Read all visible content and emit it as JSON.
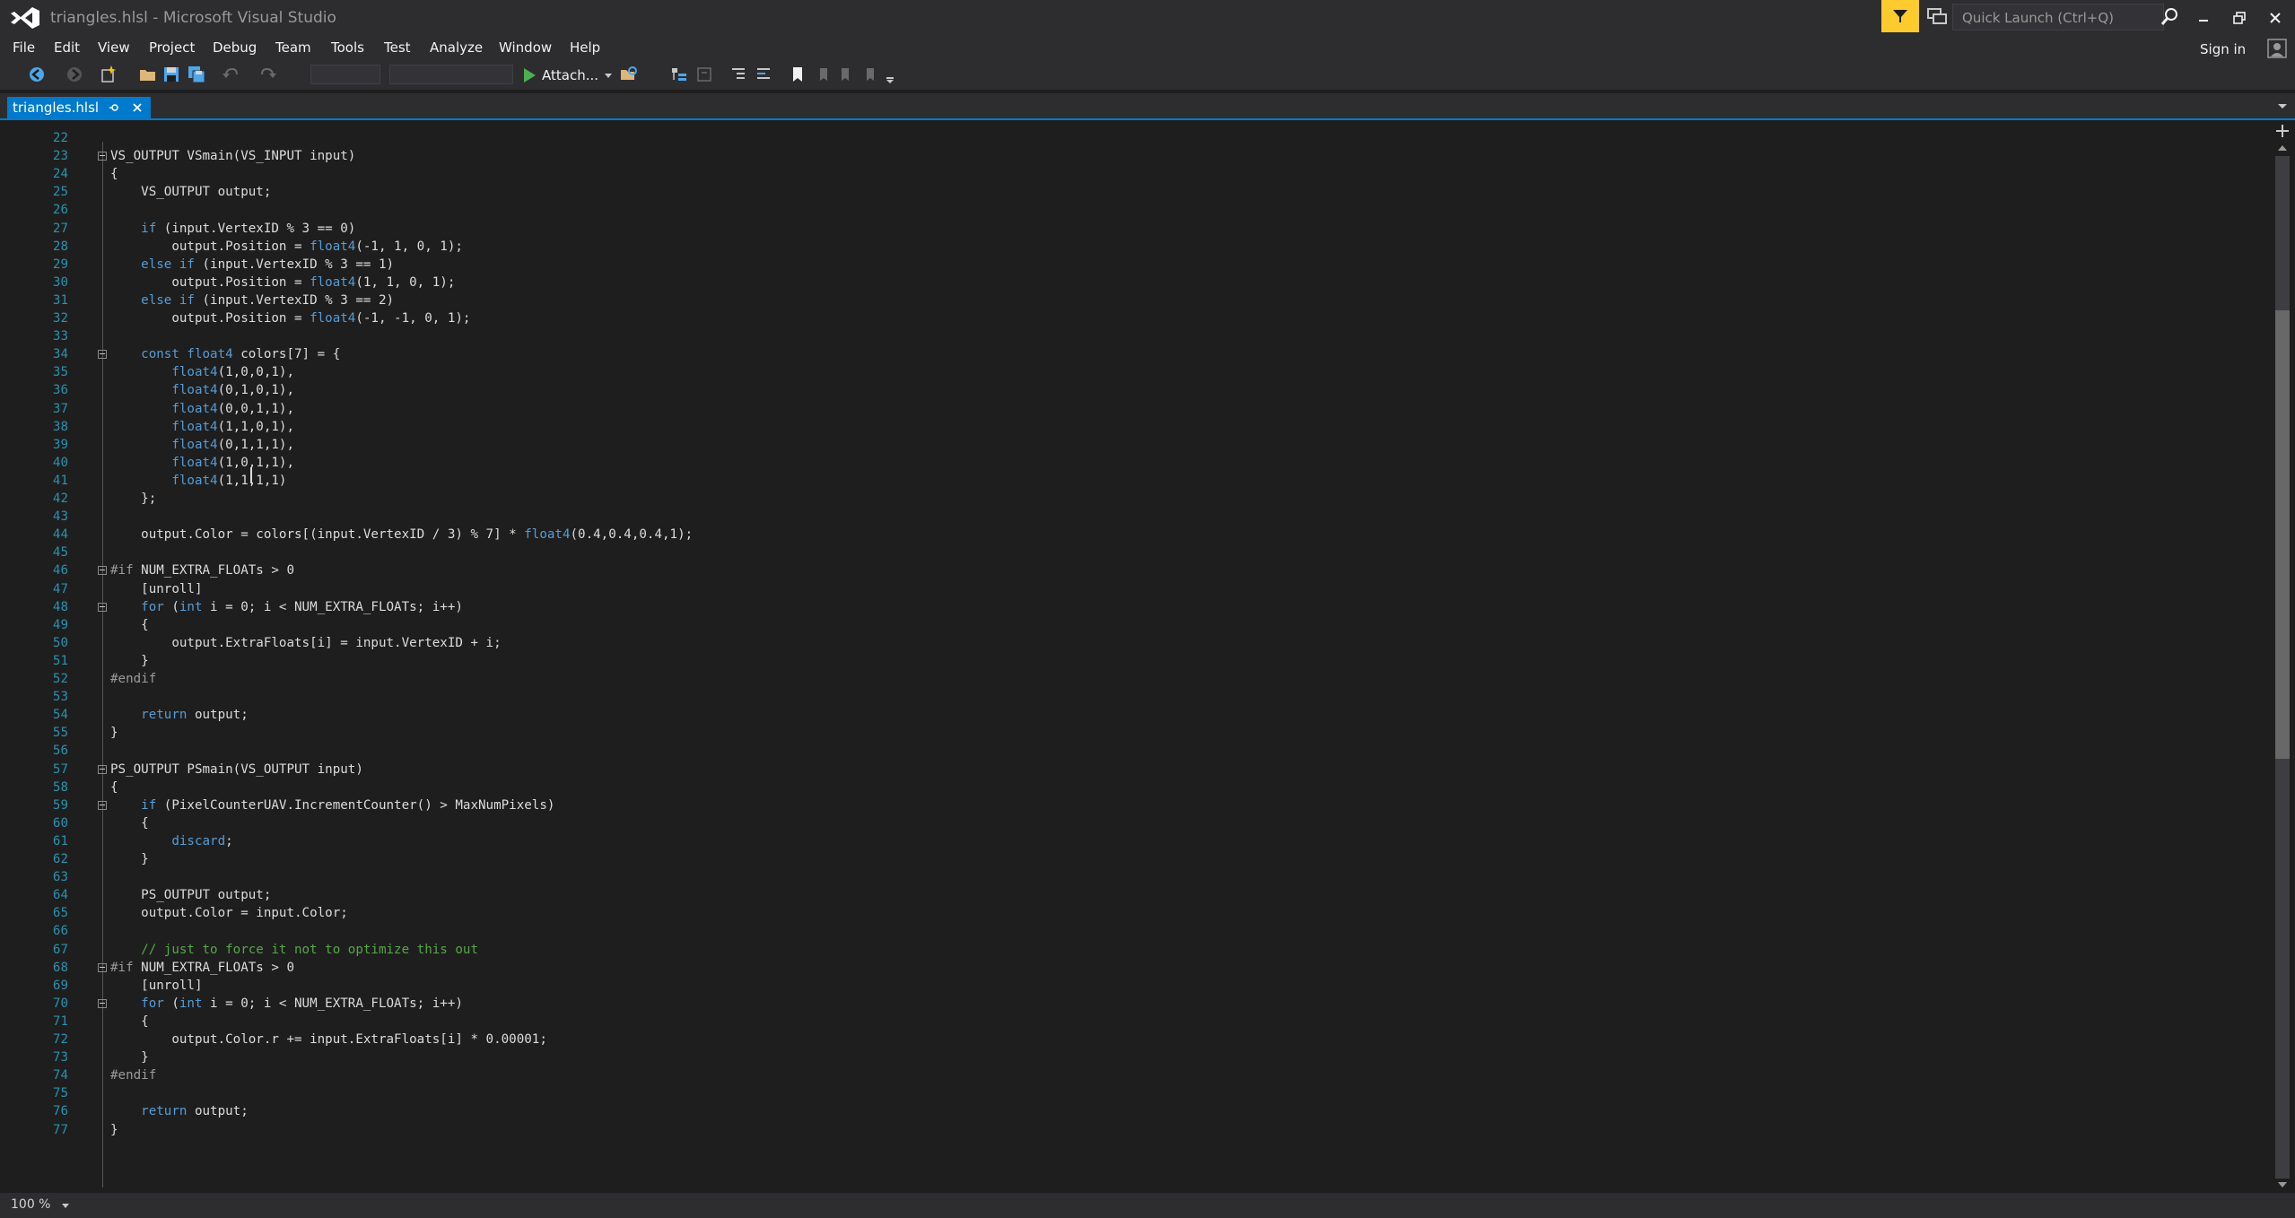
{
  "window": {
    "title": "triangles.hlsl - Microsoft Visual Studio",
    "quick_launch_placeholder": "Quick Launch (Ctrl+Q)",
    "sign_in": "Sign in",
    "accent_color": "#007acc",
    "notification_color": "#fecb2f"
  },
  "menu": [
    "File",
    "Edit",
    "View",
    "Project",
    "Debug",
    "Team",
    "Tools",
    "Test",
    "Analyze",
    "Window",
    "Help"
  ],
  "toolbar": {
    "attach_label": "Attach...",
    "icons": [
      "back-icon",
      "forward-icon",
      "new-project-icon",
      "open-file-icon",
      "save-icon",
      "save-all-icon",
      "undo-icon",
      "redo-icon",
      "start-icon",
      "find-in-files-icon",
      "indent-icon",
      "bookmark-icon"
    ]
  },
  "tab": {
    "label": "triangles.hlsl"
  },
  "status": {
    "zoom": "100 %"
  },
  "editor": {
    "lines": [
      {
        "n": "22",
        "tokens": []
      },
      {
        "n": "23",
        "fold": true,
        "tokens": [
          [
            "t",
            "VS_OUTPUT VSmain(VS_INPUT input)"
          ]
        ]
      },
      {
        "n": "24",
        "tokens": [
          [
            "t",
            "{"
          ]
        ]
      },
      {
        "n": "25",
        "tokens": [
          [
            "t",
            "    VS_OUTPUT output;"
          ]
        ]
      },
      {
        "n": "26",
        "tokens": []
      },
      {
        "n": "27",
        "tokens": [
          [
            "t",
            "    "
          ],
          [
            "k",
            "if"
          ],
          [
            "t",
            " (input.VertexID % 3 == 0)"
          ]
        ]
      },
      {
        "n": "28",
        "tokens": [
          [
            "t",
            "        output.Position = "
          ],
          [
            "k",
            "float4"
          ],
          [
            "t",
            "(-1, 1, 0, 1);"
          ]
        ]
      },
      {
        "n": "29",
        "tokens": [
          [
            "t",
            "    "
          ],
          [
            "k",
            "else if"
          ],
          [
            "t",
            " (input.VertexID % 3 == 1)"
          ]
        ]
      },
      {
        "n": "30",
        "tokens": [
          [
            "t",
            "        output.Position = "
          ],
          [
            "k",
            "float4"
          ],
          [
            "t",
            "(1, 1, 0, 1);"
          ]
        ]
      },
      {
        "n": "31",
        "tokens": [
          [
            "t",
            "    "
          ],
          [
            "k",
            "else if"
          ],
          [
            "t",
            " (input.VertexID % 3 == 2)"
          ]
        ]
      },
      {
        "n": "32",
        "tokens": [
          [
            "t",
            "        output.Position = "
          ],
          [
            "k",
            "float4"
          ],
          [
            "t",
            "(-1, -1, 0, 1);"
          ]
        ]
      },
      {
        "n": "33",
        "tokens": []
      },
      {
        "n": "34",
        "fold": true,
        "tokens": [
          [
            "t",
            "    "
          ],
          [
            "k",
            "const float4"
          ],
          [
            "t",
            " colors[7] = {"
          ]
        ]
      },
      {
        "n": "35",
        "tokens": [
          [
            "t",
            "        "
          ],
          [
            "k",
            "float4"
          ],
          [
            "t",
            "(1,0,0,1),"
          ]
        ]
      },
      {
        "n": "36",
        "tokens": [
          [
            "t",
            "        "
          ],
          [
            "k",
            "float4"
          ],
          [
            "t",
            "(0,1,0,1),"
          ]
        ]
      },
      {
        "n": "37",
        "tokens": [
          [
            "t",
            "        "
          ],
          [
            "k",
            "float4"
          ],
          [
            "t",
            "(0,0,1,1),"
          ]
        ]
      },
      {
        "n": "38",
        "tokens": [
          [
            "t",
            "        "
          ],
          [
            "k",
            "float4"
          ],
          [
            "t",
            "(1,1,0,1),"
          ]
        ]
      },
      {
        "n": "39",
        "tokens": [
          [
            "t",
            "        "
          ],
          [
            "k",
            "float4"
          ],
          [
            "t",
            "(0,1,1,1),"
          ]
        ]
      },
      {
        "n": "40",
        "tokens": [
          [
            "t",
            "        "
          ],
          [
            "k",
            "float4"
          ],
          [
            "t",
            "(1,0,1,1),"
          ]
        ]
      },
      {
        "n": "41",
        "tokens": [
          [
            "t",
            "        "
          ],
          [
            "k",
            "float4"
          ],
          [
            "t",
            "(1,1,1,1)"
          ]
        ]
      },
      {
        "n": "42",
        "tokens": [
          [
            "t",
            "    };"
          ]
        ]
      },
      {
        "n": "43",
        "tokens": []
      },
      {
        "n": "44",
        "tokens": [
          [
            "t",
            "    output.Color = colors[(input.VertexID / 3) % 7] * "
          ],
          [
            "k",
            "float4"
          ],
          [
            "t",
            "(0.4,0.4,0.4,1);"
          ]
        ]
      },
      {
        "n": "45",
        "tokens": []
      },
      {
        "n": "46",
        "fold": true,
        "tokens": [
          [
            "p",
            "#if"
          ],
          [
            "t",
            " NUM_EXTRA_FLOATs > 0"
          ]
        ]
      },
      {
        "n": "47",
        "tokens": [
          [
            "t",
            "    [unroll]"
          ]
        ]
      },
      {
        "n": "48",
        "fold": true,
        "tokens": [
          [
            "t",
            "    "
          ],
          [
            "k",
            "for"
          ],
          [
            "t",
            " ("
          ],
          [
            "k",
            "int"
          ],
          [
            "t",
            " i = 0; i < NUM_EXTRA_FLOATs; i++)"
          ]
        ]
      },
      {
        "n": "49",
        "tokens": [
          [
            "t",
            "    {"
          ]
        ]
      },
      {
        "n": "50",
        "tokens": [
          [
            "t",
            "        output.ExtraFloats[i] = input.VertexID + i;"
          ]
        ]
      },
      {
        "n": "51",
        "tokens": [
          [
            "t",
            "    }"
          ]
        ]
      },
      {
        "n": "52",
        "tokens": [
          [
            "p",
            "#endif"
          ]
        ]
      },
      {
        "n": "53",
        "tokens": []
      },
      {
        "n": "54",
        "tokens": [
          [
            "t",
            "    "
          ],
          [
            "k",
            "return"
          ],
          [
            "t",
            " output;"
          ]
        ]
      },
      {
        "n": "55",
        "tokens": [
          [
            "t",
            "}"
          ]
        ]
      },
      {
        "n": "56",
        "tokens": []
      },
      {
        "n": "57",
        "fold": true,
        "tokens": [
          [
            "t",
            "PS_OUTPUT PSmain(VS_OUTPUT input)"
          ]
        ]
      },
      {
        "n": "58",
        "tokens": [
          [
            "t",
            "{"
          ]
        ]
      },
      {
        "n": "59",
        "fold": true,
        "tokens": [
          [
            "t",
            "    "
          ],
          [
            "k",
            "if"
          ],
          [
            "t",
            " (PixelCounterUAV.IncrementCounter() > MaxNumPixels)"
          ]
        ]
      },
      {
        "n": "60",
        "tokens": [
          [
            "t",
            "    {"
          ]
        ]
      },
      {
        "n": "61",
        "tokens": [
          [
            "t",
            "        "
          ],
          [
            "k",
            "discard"
          ],
          [
            "t",
            ";"
          ]
        ]
      },
      {
        "n": "62",
        "tokens": [
          [
            "t",
            "    }"
          ]
        ]
      },
      {
        "n": "63",
        "tokens": []
      },
      {
        "n": "64",
        "tokens": [
          [
            "t",
            "    PS_OUTPUT output;"
          ]
        ]
      },
      {
        "n": "65",
        "tokens": [
          [
            "t",
            "    output.Color = input.Color;"
          ]
        ]
      },
      {
        "n": "66",
        "tokens": []
      },
      {
        "n": "67",
        "tokens": [
          [
            "t",
            "    "
          ],
          [
            "c",
            "// just to force it not to optimize this out"
          ]
        ]
      },
      {
        "n": "68",
        "fold": true,
        "tokens": [
          [
            "p",
            "#if"
          ],
          [
            "t",
            " NUM_EXTRA_FLOATs > 0"
          ]
        ]
      },
      {
        "n": "69",
        "tokens": [
          [
            "t",
            "    [unroll]"
          ]
        ]
      },
      {
        "n": "70",
        "fold": true,
        "tokens": [
          [
            "t",
            "    "
          ],
          [
            "k",
            "for"
          ],
          [
            "t",
            " ("
          ],
          [
            "k",
            "int"
          ],
          [
            "t",
            " i = 0; i < NUM_EXTRA_FLOATs; i++)"
          ]
        ]
      },
      {
        "n": "71",
        "tokens": [
          [
            "t",
            "    {"
          ]
        ]
      },
      {
        "n": "72",
        "tokens": [
          [
            "t",
            "        output.Color.r += input.ExtraFloats[i] * 0.00001;"
          ]
        ]
      },
      {
        "n": "73",
        "tokens": [
          [
            "t",
            "    }"
          ]
        ]
      },
      {
        "n": "74",
        "tokens": [
          [
            "p",
            "#endif"
          ]
        ]
      },
      {
        "n": "75",
        "tokens": []
      },
      {
        "n": "76",
        "tokens": [
          [
            "t",
            "    "
          ],
          [
            "k",
            "return"
          ],
          [
            "t",
            " output;"
          ]
        ]
      },
      {
        "n": "77",
        "tokens": [
          [
            "t",
            "}"
          ]
        ]
      }
    ]
  }
}
